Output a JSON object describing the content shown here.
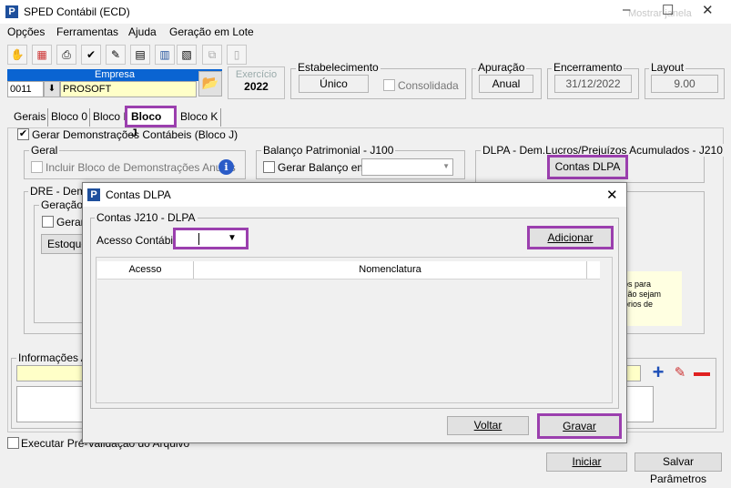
{
  "window": {
    "title": "SPED Contábil (ECD)",
    "ghost_text": "Mostrar janela"
  },
  "menu": [
    "Opções",
    "Ferramentas",
    "Ajuda",
    "Geração em Lote"
  ],
  "toolbar_icons": [
    "hand-icon",
    "grid-icon",
    "print-icon",
    "check-icon",
    "stamp-icon",
    "calculator-icon",
    "list-icon",
    "document-icon",
    "copy-disabled-icon",
    "page-disabled-icon"
  ],
  "empresa": {
    "label": "Empresa",
    "code": "0011",
    "name": "PROSOFT"
  },
  "exercicio": {
    "label": "Exercício",
    "value": "2022"
  },
  "estabelecimento": {
    "label": "Estabelecimento",
    "unico": "Único",
    "consolidada": "Consolidada"
  },
  "apuracao": {
    "label": "Apuração",
    "value": "Anual"
  },
  "encerramento": {
    "label": "Encerramento",
    "value": "31/12/2022"
  },
  "layout": {
    "label": "Layout",
    "value": "9.00"
  },
  "tabs": [
    "Gerais",
    "Bloco 0",
    "Bloco I",
    "Bloco J",
    "Bloco K"
  ],
  "bloco_j": {
    "gerar_label": "Gerar Demonstrações Contábeis (Bloco J)",
    "geral": {
      "label": "Geral",
      "incluir": "Incluir Bloco de Demonstrações Anuais"
    },
    "balanco": {
      "label": "Balanço Patrimonial - J100",
      "gerar": "Gerar Balanço em"
    },
    "dlpa": {
      "label": "DLPA - Dem.Lucros/Prejuízos Acumulados - J210",
      "button": "Contas DLPA"
    },
    "dre": {
      "label": "DRE - Demo",
      "geracao": "Geração d",
      "gerar": "Gerar",
      "estoque": "Estoque"
    },
    "note": "os para\nção sejam\nórios de"
  },
  "informacoes": {
    "label": "Informações A"
  },
  "executar": "Executar Pré-Validação do Arquivo",
  "bottom_buttons": {
    "iniciar": "Iniciar",
    "salvar": "Salvar Parâmetros"
  },
  "dialog": {
    "title": "Contas DLPA",
    "group": "Contas J210 - DLPA",
    "acesso_label": "Acesso Contábil:",
    "acesso_value": "",
    "adicionar": "Adicionar",
    "columns": [
      "Acesso",
      "Nomenclatura"
    ],
    "rows": [],
    "voltar": "Voltar",
    "gravar": "Gravar"
  }
}
